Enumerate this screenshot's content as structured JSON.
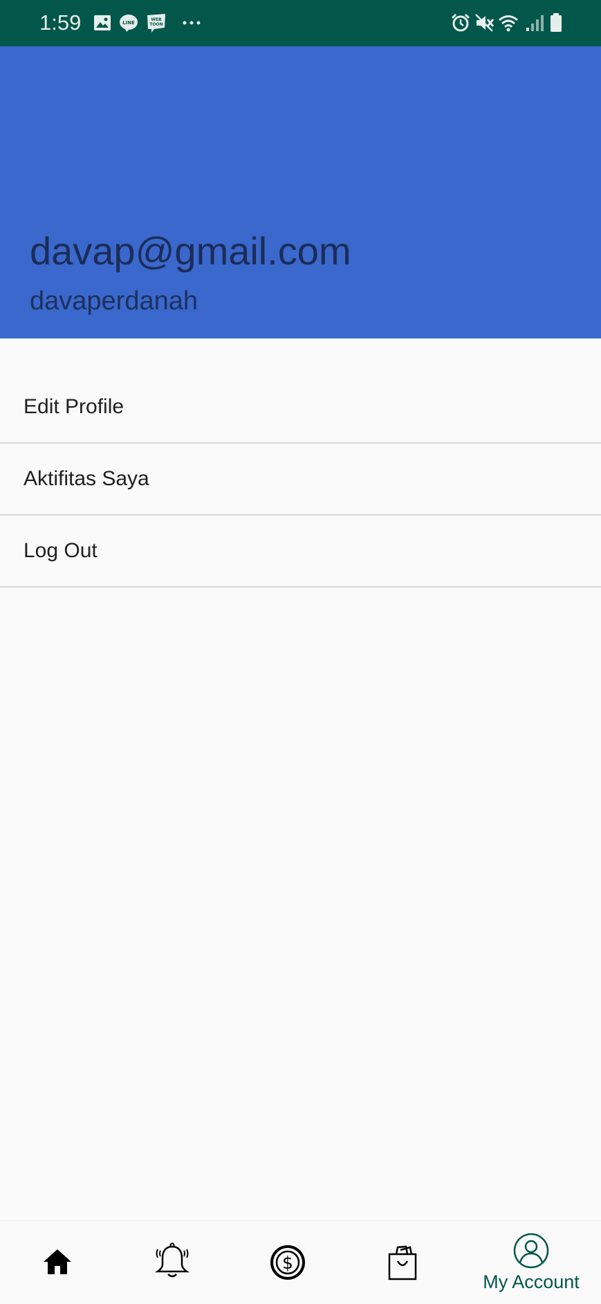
{
  "status_bar": {
    "time": "1:59",
    "background": "#02574a",
    "left_icons": [
      "gallery-icon",
      "line-app-icon",
      "webtoon-icon",
      "more-dots-icon"
    ],
    "right_icons": [
      "alarm-icon",
      "mute-icon",
      "wifi-icon",
      "signal-icon",
      "battery-icon"
    ]
  },
  "profile": {
    "email": "davap@gmail.com",
    "username": "davaperdanah",
    "header_color": "#3a68cc"
  },
  "menu": {
    "items": [
      {
        "label": "Edit Profile"
      },
      {
        "label": "Aktifitas Saya"
      },
      {
        "label": "Log Out"
      }
    ]
  },
  "bottom_nav": {
    "active_color": "#02574a",
    "items": [
      {
        "icon": "home-icon",
        "label": ""
      },
      {
        "icon": "bell-icon",
        "label": ""
      },
      {
        "icon": "dollar-coin-icon",
        "label": ""
      },
      {
        "icon": "shopping-bag-icon",
        "label": ""
      },
      {
        "icon": "account-icon",
        "label": "My Account",
        "active": true
      }
    ]
  }
}
